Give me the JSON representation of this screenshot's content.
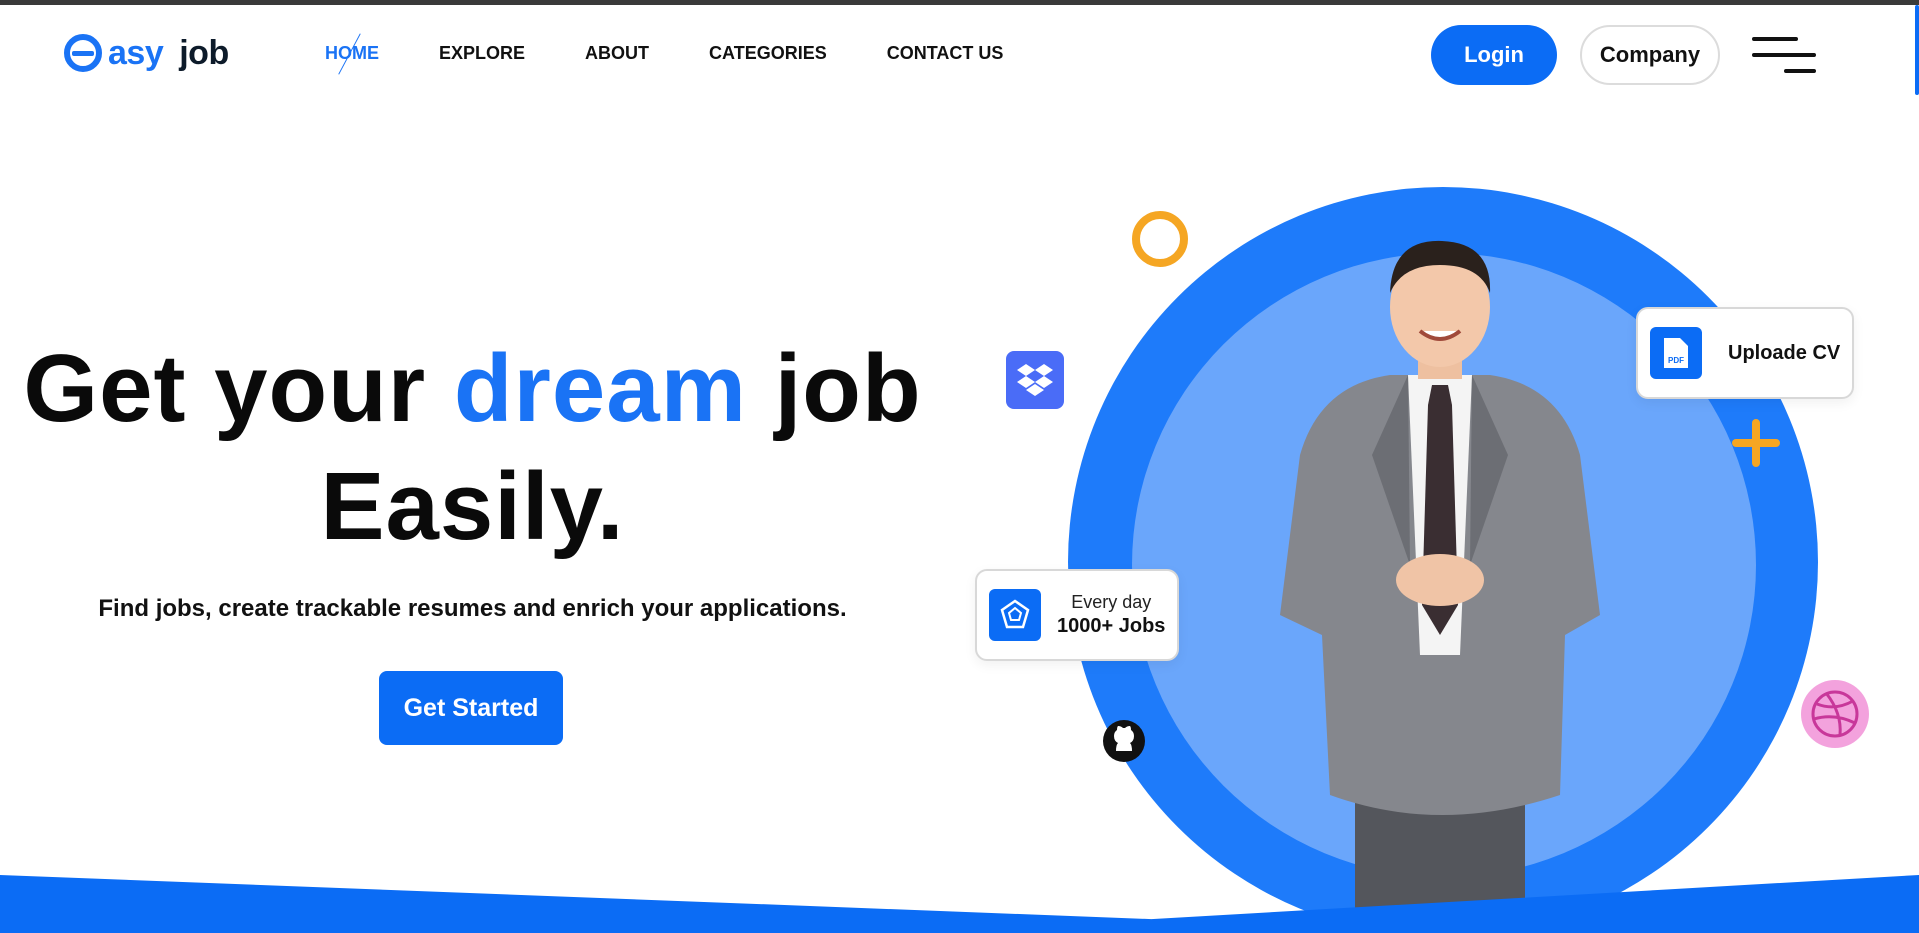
{
  "brand": {
    "logo_easy": "asy",
    "logo_job": "job"
  },
  "nav": {
    "items": [
      {
        "label": "HOME",
        "active": true
      },
      {
        "label": "EXPLORE",
        "active": false
      },
      {
        "label": "ABOUT",
        "active": false
      },
      {
        "label": "CATEGORIES",
        "active": false
      },
      {
        "label": "CONTACT US",
        "active": false
      }
    ]
  },
  "header": {
    "login_label": "Login",
    "company_label": "Company",
    "menu_icon": "hamburger-menu-icon"
  },
  "hero": {
    "title_part1": "Get your ",
    "title_accent": "dream",
    "title_part2": " job",
    "title_line2": "Easily.",
    "subtitle": "Find jobs, create trackable resumes and enrich your applications.",
    "cta_label": "Get Started"
  },
  "cards": {
    "cv_label": "Uploade CV",
    "cv_icon_text": "PDF",
    "jobs_small": "Every day",
    "jobs_big": "1000+ Jobs"
  },
  "colors": {
    "accent": "#1a73f5",
    "button_blue": "#0b6cf5",
    "circle_outer": "#1e7bfa",
    "circle_inner": "#6aa6fb",
    "orange": "#f5a623",
    "dribbble_pink": "#ea4c89"
  },
  "icons": [
    "dropbox-icon",
    "github-icon",
    "dribbble-icon",
    "pdf-file-icon",
    "dodecahedron-icon",
    "orange-ring-shape",
    "orange-plus-shape"
  ]
}
